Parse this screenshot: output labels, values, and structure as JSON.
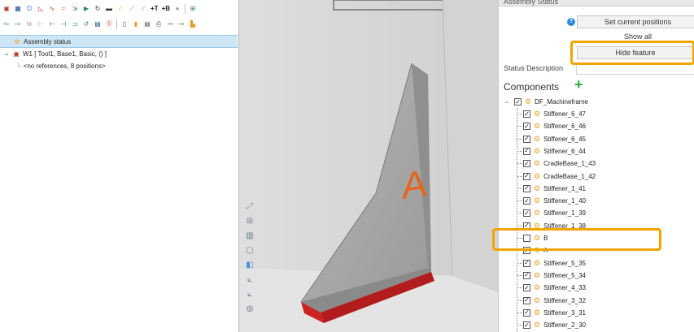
{
  "toolbar": {
    "row1": [
      "model-icon",
      "grid-icon",
      "fixture-icon",
      "angle-icon",
      "curve-icon",
      "points-icon",
      "transform-icon",
      "play-icon",
      "refresh-icon",
      "folder-icon",
      "path-icon",
      "path-icon",
      "path-icon",
      "text",
      "text",
      "dot-icon",
      "export-icon"
    ],
    "row1_text": [
      "+T",
      "+B"
    ],
    "row2": [
      "list-icon",
      "arrow-icon",
      "copy-icon",
      "branch-icon",
      "branch-icon",
      "branch-icon",
      "branch-icon",
      "branch-icon",
      "cycle-icon",
      "save-icon",
      "s-icon",
      "clipboard-icon",
      "note-icon",
      "doc-icon",
      "print-icon",
      "minus-icon",
      "wave-icon",
      "chart-icon"
    ]
  },
  "tree": {
    "items": [
      {
        "label": "Assembly status"
      },
      {
        "label": "W1  [ Tool1, Base1, Basic, () ]"
      },
      {
        "label": "<no references, 8 positions>"
      }
    ]
  },
  "panel": {
    "title": "Assembly Status",
    "set_current_positions": "Set current positions",
    "show_all": "Show all",
    "hide_feature": "Hide feature",
    "status_description_label": "Status Description",
    "components_label": "Components",
    "root": "DF_Machineframe",
    "components": [
      {
        "label": "Stiffener_6_47",
        "checked": true
      },
      {
        "label": "Stiffener_6_46",
        "checked": true
      },
      {
        "label": "Stiffener_6_45",
        "checked": true
      },
      {
        "label": "Stiffener_6_44",
        "checked": true
      },
      {
        "label": "CradleBase_1_43",
        "checked": true
      },
      {
        "label": "CradleBase_1_42",
        "checked": true
      },
      {
        "label": "Stiffener_1_41",
        "checked": true
      },
      {
        "label": "Stiffener_1_40",
        "checked": true
      },
      {
        "label": "Stiffener_1_39",
        "checked": true
      },
      {
        "label": "Stiffener_1_38",
        "checked": true
      },
      {
        "label": "B",
        "checked": false
      },
      {
        "label": "A",
        "checked": true
      },
      {
        "label": "Stiffener_5_35",
        "checked": true
      },
      {
        "label": "Stiffener_5_34",
        "checked": true
      },
      {
        "label": "Stiffener_4_33",
        "checked": true
      },
      {
        "label": "Stiffener_3_32",
        "checked": true
      },
      {
        "label": "Stiffener_3_31",
        "checked": true
      },
      {
        "label": "Stiffener_2_30",
        "checked": true
      }
    ]
  },
  "viewport": {
    "part_label": "A"
  },
  "colors": {
    "highlight": "#f0a500",
    "selection": "#cfe6f7",
    "component_icon": "#e8a31c",
    "add_icon": "#2eaa3c"
  }
}
